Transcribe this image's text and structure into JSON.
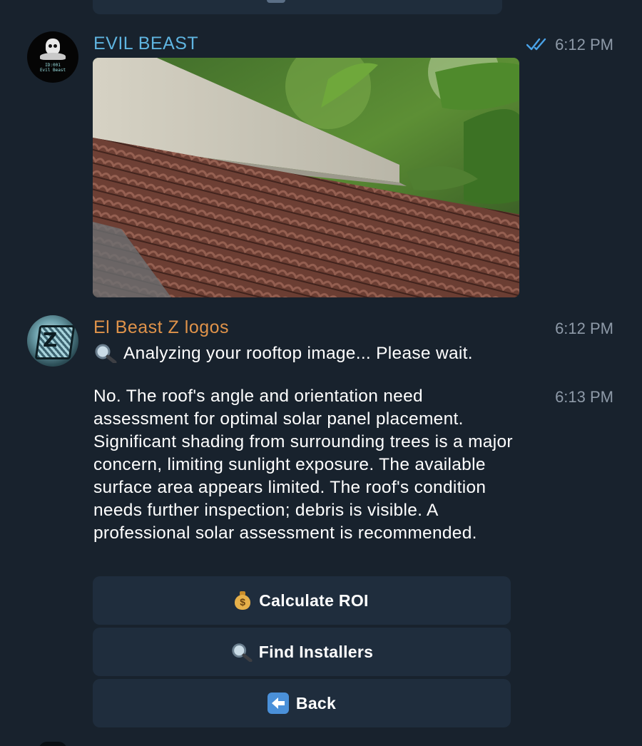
{
  "colors": {
    "background": "#18222d",
    "bubble_button": "#1f2d3d",
    "sender_beast": "#5fb4e0",
    "sender_logos": "#e0934a",
    "time": "#8e9aa8",
    "check_marks": "#4aa3e8"
  },
  "messages": [
    {
      "sender": "EVIL BEAST",
      "avatar_lines": [
        "ID:001",
        "Evil Beast"
      ],
      "time": "6:12 PM",
      "status_icon": "double-check-icon",
      "attachment": "photo-rooftop"
    },
    {
      "sender": "El Beast Z logos",
      "avatar_letter": "Z",
      "time": "6:12 PM",
      "text": "Analyzing your rooftop image... Please wait.",
      "text_icon": "magnifier-icon"
    },
    {
      "time": "6:13 PM",
      "text": "No.  The roof's angle and orientation need assessment for optimal solar panel placement.  Significant shading from surrounding trees is a major concern, limiting sunlight exposure.  The available surface area appears limited.  The roof's condition needs further inspection; debris is visible.  A professional solar assessment is recommended."
    }
  ],
  "keyboard": {
    "buttons": [
      {
        "label": "Calculate ROI",
        "icon": "money-bag-icon"
      },
      {
        "label": "Find Installers",
        "icon": "magnifier-icon"
      },
      {
        "label": "Back",
        "icon": "back-arrow-icon"
      }
    ]
  }
}
